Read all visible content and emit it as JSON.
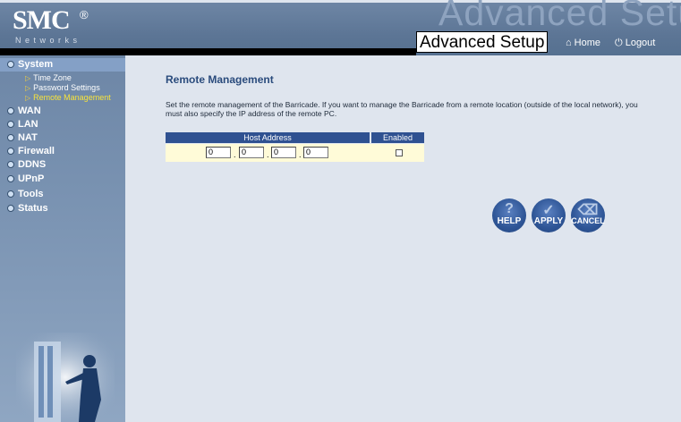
{
  "header": {
    "logo": "SMC",
    "logo_mark": "®",
    "logo_sub": "Networks",
    "watermark": "Advanced Setup",
    "page_heading": "Advanced Setup",
    "home_label": "Home",
    "logout_label": "Logout"
  },
  "sidebar": {
    "items": [
      {
        "label": "System"
      },
      {
        "label": "WAN"
      },
      {
        "label": "LAN"
      },
      {
        "label": "NAT"
      },
      {
        "label": "Firewall"
      },
      {
        "label": "DDNS"
      },
      {
        "label": "UPnP"
      },
      {
        "label": "Tools"
      },
      {
        "label": "Status"
      }
    ],
    "system_sub": [
      {
        "label": "Time Zone"
      },
      {
        "label": "Password Settings"
      },
      {
        "label": "Remote Management"
      }
    ]
  },
  "content": {
    "title": "Remote Management",
    "description": "Set the remote management of the Barricade. If you want to manage the Barricade from a remote location (outside of the local network), you must also specify the IP address of the remote PC.",
    "table": {
      "host_header": "Host Address",
      "enabled_header": "Enabled",
      "ip": [
        "0",
        "0",
        "0",
        "0"
      ],
      "enabled": false
    },
    "buttons": {
      "help": "HELP",
      "apply": "APPLY",
      "cancel": "CANCEL"
    }
  },
  "colors": {
    "header_bg": "#5c7595",
    "sidebar_bg": "#7a93b2",
    "content_bg": "#dfe5ee",
    "table_header": "#2f5191",
    "row_bg": "#fffbd8",
    "title_text": "#2a4b7c",
    "active_sub": "#f7e33a"
  },
  "icons": {
    "home": "home-icon",
    "logout": "power-icon",
    "help": "question-icon",
    "apply": "check-icon",
    "cancel": "trash-icon"
  }
}
